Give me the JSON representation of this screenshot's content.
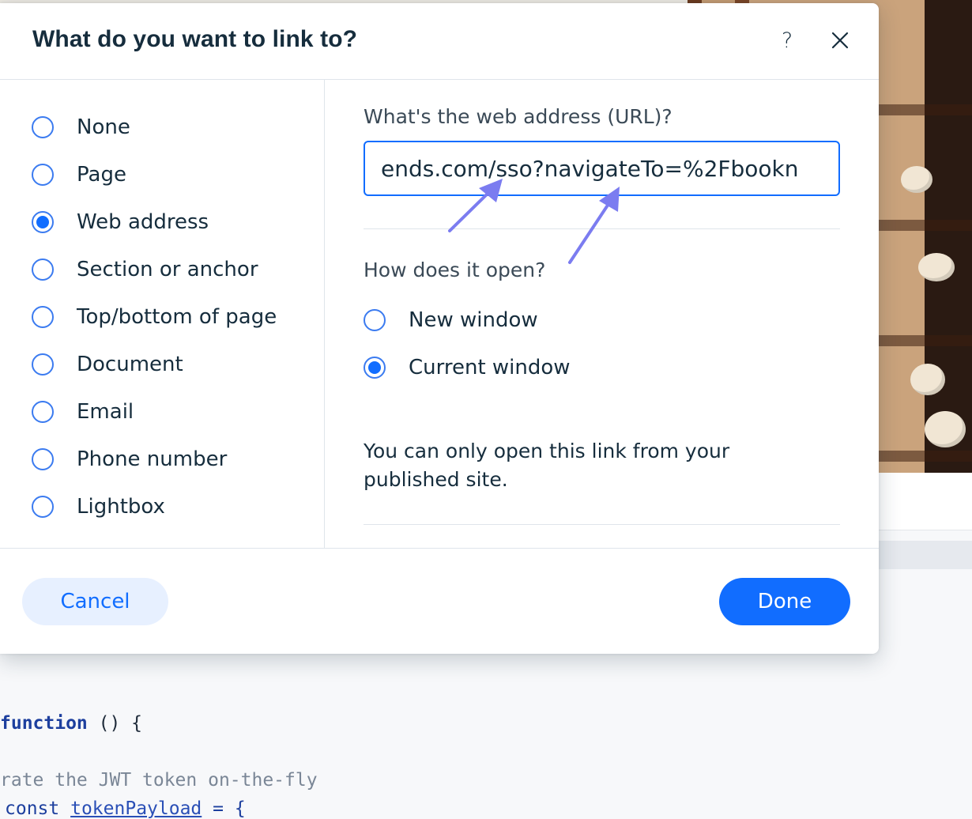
{
  "dialog": {
    "title": "What do you want to link to?",
    "help_label": "?",
    "close_icon": "close-icon"
  },
  "link_types": [
    {
      "label": "None",
      "selected": false
    },
    {
      "label": "Page",
      "selected": false
    },
    {
      "label": "Web address",
      "selected": true
    },
    {
      "label": "Section or anchor",
      "selected": false
    },
    {
      "label": "Top/bottom of page",
      "selected": false
    },
    {
      "label": "Document",
      "selected": false
    },
    {
      "label": "Email",
      "selected": false
    },
    {
      "label": "Phone number",
      "selected": false
    },
    {
      "label": "Lightbox",
      "selected": false
    }
  ],
  "web_address": {
    "label": "What's the web address (URL)?",
    "visible_value": "ends.com/sso?navigateTo=%2Fbookn",
    "open_label": "How does it open?",
    "open_options": [
      {
        "label": "New window",
        "selected": false
      },
      {
        "label": "Current window",
        "selected": true
      }
    ],
    "note": "You can only open this link from your published site."
  },
  "footer": {
    "cancel_label": "Cancel",
    "done_label": "Done"
  },
  "background_code": {
    "line1_keyword": "function",
    "line1_rest": " () {",
    "line2": "rate the JWT token on-the-fly",
    "line3_keyword": "const",
    "line3_var": "tokenPayload",
    "line3_rest": " = {"
  },
  "colors": {
    "accent": "#116dff",
    "annotation_arrow": "#7b7cf0",
    "title_text": "#162d3d"
  }
}
